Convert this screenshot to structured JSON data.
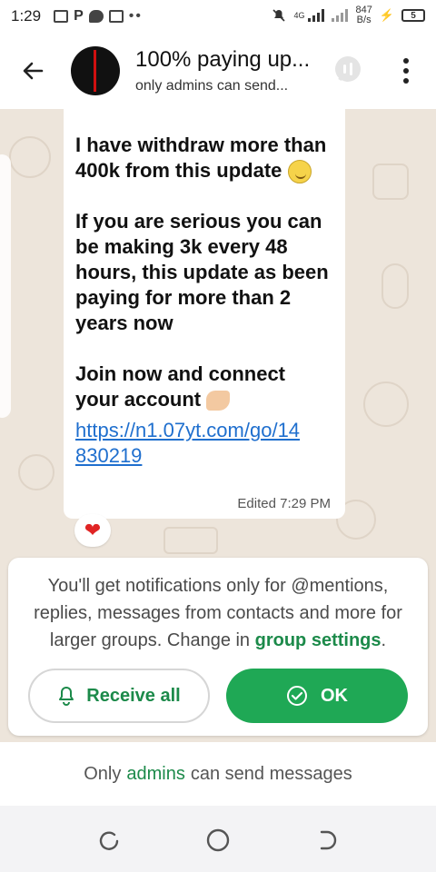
{
  "status_bar": {
    "time": "1:29",
    "network": "4G",
    "speed_value": "847",
    "speed_unit": "B/s",
    "battery": "5"
  },
  "header": {
    "title": "100% paying up...",
    "subtitle": "only admins can send..."
  },
  "message": {
    "paragraph1": "I have withdraw more than 400k from this update",
    "paragraph2": "If you are serious you can be making 3k every 48 hours, this update as been paying for more than 2 years now",
    "paragraph3": "Join now and connect your account",
    "link": "https://n1.07yt.com/go/14830219",
    "edited_label": "Edited",
    "time": "7:29 PM",
    "reaction": "❤"
  },
  "notice": {
    "text_before": "You'll get notifications only for @mentions, replies, messages from contacts and more for larger groups. Change in",
    "link_text": "group settings",
    "text_after": ".",
    "receive_all_label": "Receive all",
    "ok_label": "OK"
  },
  "footer": {
    "prefix": "Only",
    "admins": "admins",
    "suffix": "can send messages"
  },
  "colors": {
    "accent_green": "#1fa855",
    "link_blue": "#1f6fce",
    "chat_background": "#ede5db"
  },
  "icons": [
    "back-arrow-icon",
    "voice-chat-icon",
    "more-vertical-icon",
    "bell-icon",
    "check-circle-icon",
    "recents-icon",
    "home-icon",
    "back-nav-icon"
  ]
}
